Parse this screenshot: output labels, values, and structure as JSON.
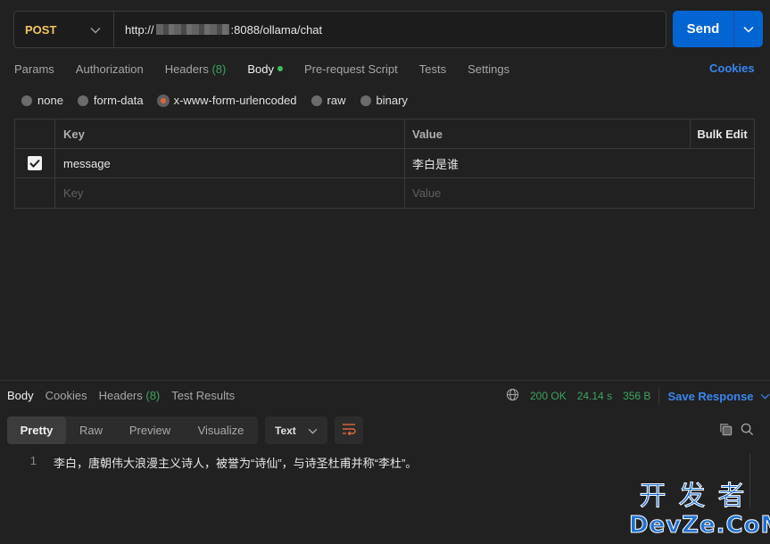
{
  "request": {
    "method": "POST",
    "url_prefix": "http://",
    "url_suffix": ":8088/ollama/chat",
    "send_label": "Send"
  },
  "req_tabs": {
    "params": "Params",
    "authorization": "Authorization",
    "headers": "Headers",
    "headers_count": "(8)",
    "body": "Body",
    "pre_request": "Pre-request Script",
    "tests": "Tests",
    "settings": "Settings",
    "cookies": "Cookies"
  },
  "body_types": {
    "none": "none",
    "form_data": "form-data",
    "urlencoded": "x-www-form-urlencoded",
    "raw": "raw",
    "binary": "binary",
    "selected": "x-www-form-urlencoded"
  },
  "kv_table": {
    "key_header": "Key",
    "value_header": "Value",
    "bulk_edit": "Bulk Edit",
    "rows": [
      {
        "checked": true,
        "key": "message",
        "value": "李白是谁"
      }
    ],
    "key_placeholder": "Key",
    "value_placeholder": "Value"
  },
  "response": {
    "tabs": {
      "body": "Body",
      "cookies": "Cookies",
      "headers": "Headers",
      "headers_count": "(8)",
      "test_results": "Test Results"
    },
    "status": "200 OK",
    "time": "24.14 s",
    "size": "356 B",
    "save_response": "Save Response",
    "views": {
      "pretty": "Pretty",
      "raw": "Raw",
      "preview": "Preview",
      "visualize": "Visualize"
    },
    "format": "Text",
    "lines": [
      {
        "num": "1",
        "text": "李白，唐朝伟大浪漫主义诗人，被誉为“诗仙”，与诗圣杜甫并称“李杜”。"
      }
    ]
  },
  "watermark": {
    "top": "开发者",
    "bottom": "DevZe.CoM"
  },
  "colors": {
    "accent": "#0265d2",
    "link": "#3a86f0",
    "method": "#f0c75e",
    "success": "#3ea35f",
    "background": "#212121"
  }
}
